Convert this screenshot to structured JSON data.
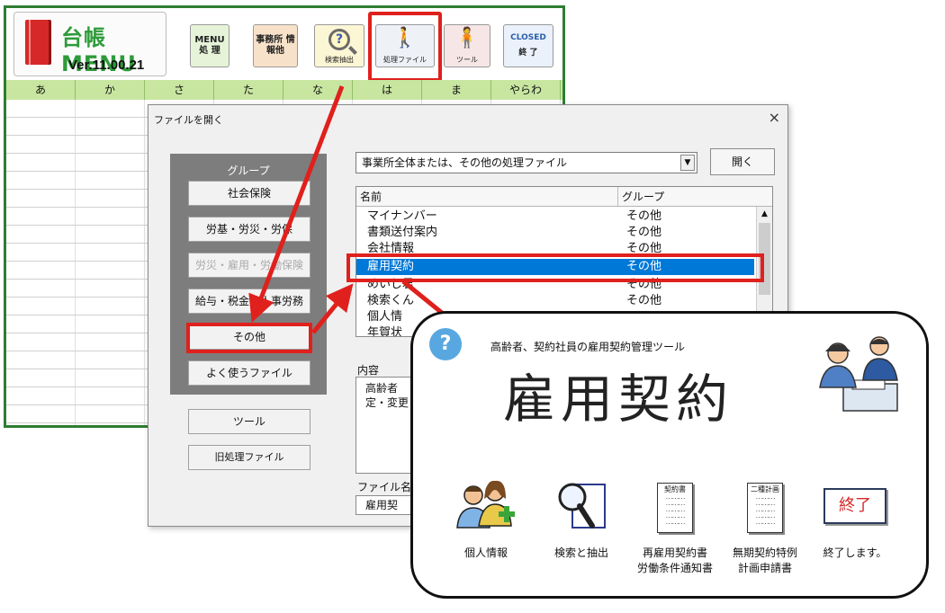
{
  "main_menu": {
    "app_title": "台帳MENU",
    "version": "Ver.11.00.21",
    "buttons": {
      "menu": "MENU 処 理",
      "office": "事務所 情報他",
      "search": "検索抽出",
      "proc_file": "処理ファイル",
      "tool": "ツール",
      "closed_top": "CLOSED",
      "closed_bottom": "終 了"
    },
    "kana_tabs": [
      "あ",
      "か",
      "さ",
      "た",
      "な",
      "は",
      "ま",
      "やらわ"
    ]
  },
  "dialog": {
    "title": "ファイルを開く",
    "close": "×",
    "group_label": "グループ",
    "group_buttons": [
      "社会保険",
      "労基・労災・労保",
      "労災・雇用・労働保険",
      "給与・税金・人事労務",
      "その他",
      "よく使うファイル"
    ],
    "extra_buttons": [
      "ツール",
      "旧処理ファイル"
    ],
    "type_select": "事業所全体または、その他の処理ファイル",
    "open_button": "開く",
    "list_headers": {
      "name": "名前",
      "group": "グループ"
    },
    "files": [
      {
        "name": "マイナンバー",
        "group": "その他"
      },
      {
        "name": "書類送付案内",
        "group": "その他"
      },
      {
        "name": "会社情報",
        "group": "その他"
      },
      {
        "name": "雇用契約",
        "group": "その他",
        "selected": true
      },
      {
        "name": "めいじ君",
        "group": "その他"
      },
      {
        "name": "検索くん",
        "group": "その他"
      },
      {
        "name": "個人情",
        "group": ""
      },
      {
        "name": "年賀状",
        "group": ""
      }
    ],
    "content_label": "内容",
    "content_lines": [
      "高齢者",
      "定・変更"
    ],
    "filename_label": "ファイル名",
    "filename_value": "雇用契"
  },
  "card": {
    "help": "?",
    "subtitle": "高齢者、契約社員の雇用契約管理ツール",
    "title": "雇用契約",
    "items": [
      {
        "label": "個人情報"
      },
      {
        "label": "検索と抽出"
      },
      {
        "label": "再雇用契約書\n労働条件通知書",
        "doc_title": "契約書"
      },
      {
        "label": "無期契約特例\n計画申請書",
        "doc_title": "二種計画"
      },
      {
        "label": "終了します。",
        "button": "終了"
      }
    ]
  },
  "colors": {
    "menu_green": "#2e9b3a",
    "highlight_red": "#e0201c",
    "selection_blue": "#0078d7",
    "kana_row": "#c8e6a0"
  }
}
